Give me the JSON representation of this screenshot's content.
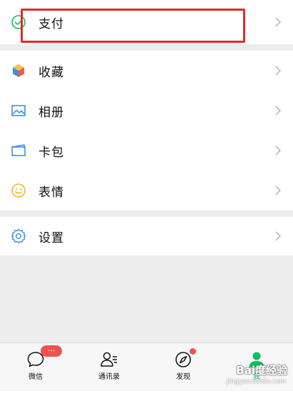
{
  "menu": {
    "pay": {
      "label": "支付",
      "icon": "pay-check-icon"
    },
    "items": [
      {
        "label": "收藏",
        "icon": "favorites-cube-icon"
      },
      {
        "label": "相册",
        "icon": "album-image-icon"
      },
      {
        "label": "卡包",
        "icon": "card-wallet-icon"
      },
      {
        "label": "表情",
        "icon": "sticker-smile-icon"
      }
    ],
    "settings": {
      "label": "设置",
      "icon": "settings-gear-icon"
    }
  },
  "tabbar": {
    "tabs": [
      {
        "label": "微信",
        "icon": "chat-bubble-icon",
        "badge": "···"
      },
      {
        "label": "通讯录",
        "icon": "contacts-icon"
      },
      {
        "label": "发现",
        "icon": "compass-icon",
        "dot": true
      },
      {
        "label": "我",
        "icon": "me-person-icon",
        "active": true
      }
    ]
  },
  "watermark": {
    "text": "Bai度经验",
    "sub": "jingyan.baidu.com"
  },
  "colors": {
    "accent_green": "#07c160",
    "highlight_red": "#e5282b",
    "badge_red": "#f05251"
  }
}
